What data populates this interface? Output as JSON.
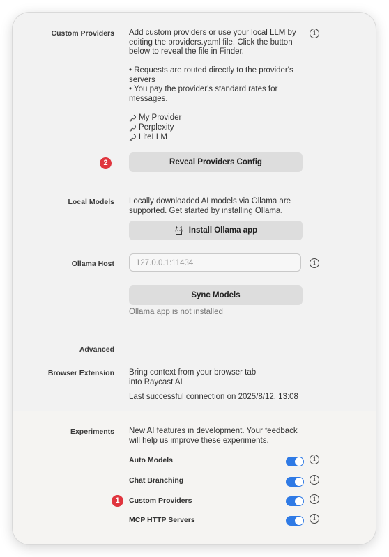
{
  "custom_providers": {
    "label": "Custom Providers",
    "description": "Add custom providers or use your local LLM by editing the providers.yaml file. Click the button below to reveal the file in Finder.",
    "bullet1": "• Requests are routed directly to the provider's servers",
    "bullet2": "• You pay the provider's standard rates for messages.",
    "providers": [
      "My Provider",
      "Perplexity",
      "LiteLLM"
    ],
    "reveal_button": "Reveal Providers Config",
    "badge": "2"
  },
  "local_models": {
    "label": "Local Models",
    "description": "Locally downloaded AI models via Ollama are supported. Get started by installing Ollama.",
    "install_button": "Install Ollama app"
  },
  "ollama_host": {
    "label": "Ollama Host",
    "placeholder": "127.0.0.1:11434",
    "sync_button": "Sync Models",
    "status": "Ollama app is not installed"
  },
  "advanced": {
    "label": "Advanced"
  },
  "browser_extension": {
    "label": "Browser Extension",
    "description": "Bring context from your browser tab into Raycast AI",
    "last_connection": "Last successful connection on 2025/8/12, 13:08"
  },
  "experiments": {
    "label": "Experiments",
    "description": "New AI features in development. Your feedback will help us improve these experiments.",
    "items": [
      {
        "label": "Auto Models",
        "enabled": true
      },
      {
        "label": "Chat Branching",
        "enabled": true
      },
      {
        "label": "Custom Providers",
        "enabled": true
      },
      {
        "label": "MCP HTTP Servers",
        "enabled": true
      }
    ],
    "badge": "1"
  },
  "colors": {
    "accent": "#2f7ae5",
    "badge": "#e0353e"
  },
  "icons": {
    "info": "info-icon",
    "provider": "key-icon",
    "ollama": "ollama-llama-icon"
  }
}
